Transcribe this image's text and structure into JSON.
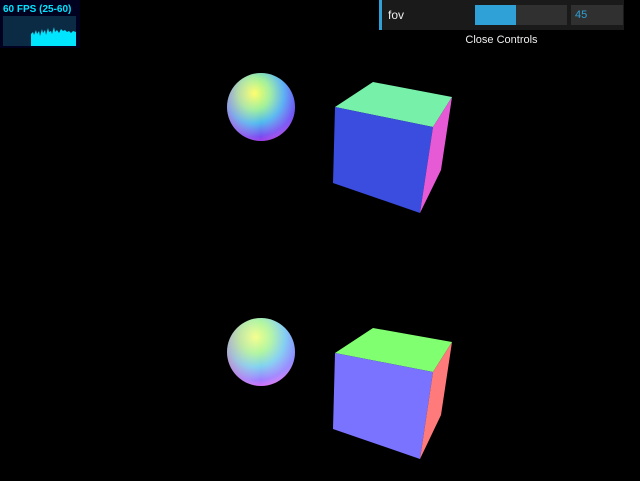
{
  "stats": {
    "label": "60 FPS (25-60)",
    "fps": 60,
    "min": 25,
    "max": 60
  },
  "gui": {
    "fov_label": "fov",
    "fov_value": "45",
    "fov_fraction": 0.45,
    "close_label": "Close Controls"
  },
  "colors": {
    "gui_accent": "#2fa1d6",
    "gui_row_bg": "#1a1a1a",
    "stats_text": "#00e5ff",
    "background": "#000000"
  },
  "scene": {
    "objects": [
      {
        "name": "top-sphere",
        "shape": "sphere",
        "material": "normal"
      },
      {
        "name": "top-cube",
        "shape": "cube",
        "material": "normal",
        "faces": {
          "top": "#77f0aa",
          "front": "#3a4ddf",
          "side": "#e75ad6"
        }
      },
      {
        "name": "bottom-sphere",
        "shape": "sphere",
        "material": "normal"
      },
      {
        "name": "bottom-cube",
        "shape": "cube",
        "material": "normal",
        "faces": {
          "top": "#80ff70",
          "front": "#7a73ff",
          "side": "#ff7a7a"
        }
      }
    ]
  }
}
